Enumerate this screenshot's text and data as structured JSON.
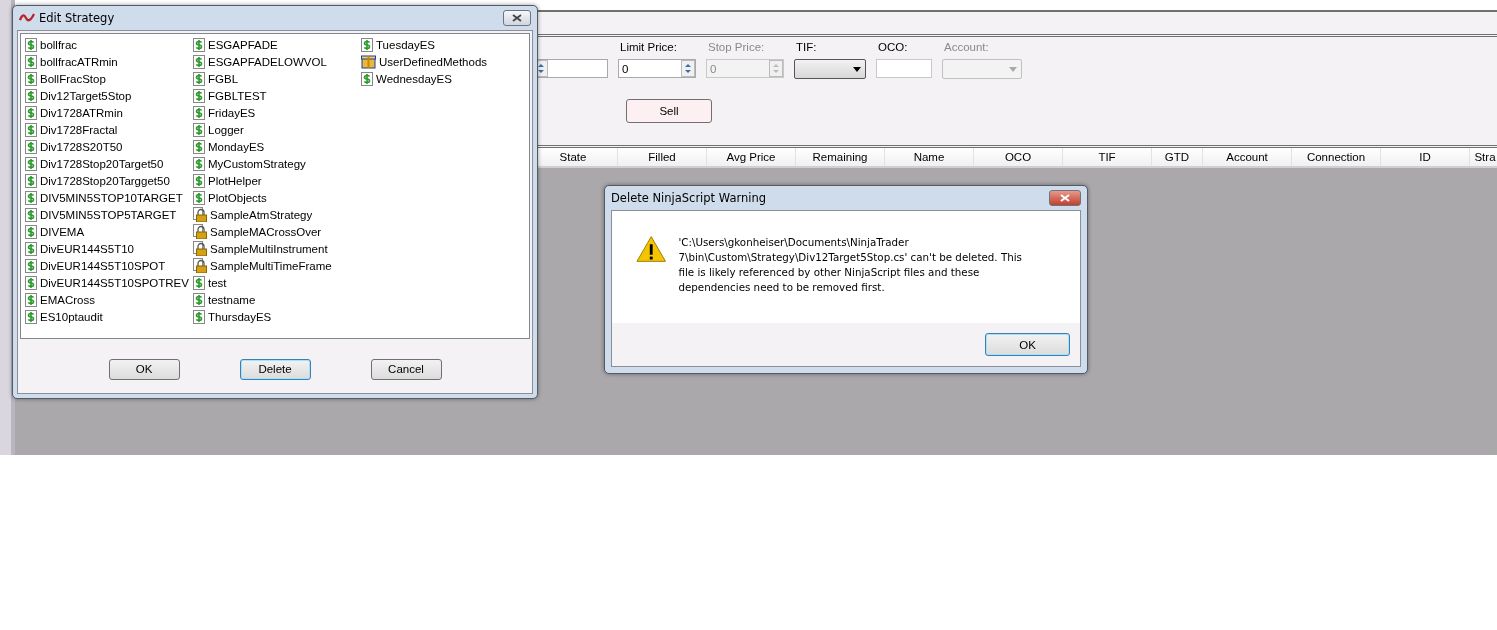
{
  "order_entry": {
    "fields": [
      {
        "kind": "spin",
        "disabled": false
      },
      {
        "kind": "spin",
        "label": "Limit Price:",
        "value": "0",
        "disabled": false
      },
      {
        "kind": "spin",
        "label": "Stop Price:",
        "value": "0",
        "disabled": true
      },
      {
        "kind": "dropdown",
        "label": "TIF:",
        "disabled": false
      },
      {
        "kind": "text",
        "label": "OCO:",
        "disabled": false
      },
      {
        "kind": "dropdown",
        "label": "Account:",
        "disabled": true
      }
    ],
    "sell_button": "Sell"
  },
  "orders_table": {
    "columns": [
      "State",
      "Filled",
      "Avg Price",
      "Remaining",
      "Name",
      "OCO",
      "TIF",
      "GTD",
      "Account",
      "Connection",
      "ID",
      "Stra"
    ]
  },
  "edit_strategy": {
    "title": "Edit Strategy",
    "items": [
      {
        "name": "bollfrac",
        "kind": "script"
      },
      {
        "name": "bollfracATRmin",
        "kind": "script"
      },
      {
        "name": "BollFracStop",
        "kind": "script"
      },
      {
        "name": "Div12Target5Stop",
        "kind": "script"
      },
      {
        "name": "Div1728ATRmin",
        "kind": "script"
      },
      {
        "name": "Div1728Fractal",
        "kind": "script"
      },
      {
        "name": "Div1728S20T50",
        "kind": "script"
      },
      {
        "name": "Div1728Stop20Target50",
        "kind": "script"
      },
      {
        "name": "Div1728Stop20Targget50",
        "kind": "script"
      },
      {
        "name": "DIV5MIN5STOP10TARGET",
        "kind": "script"
      },
      {
        "name": "DIV5MIN5STOP5TARGET",
        "kind": "script"
      },
      {
        "name": "DIVEMA",
        "kind": "script"
      },
      {
        "name": "DivEUR144S5T10",
        "kind": "script"
      },
      {
        "name": "DivEUR144S5T10SPOT",
        "kind": "script"
      },
      {
        "name": "DivEUR144S5T10SPOTREV",
        "kind": "script"
      },
      {
        "name": "EMACross",
        "kind": "script"
      },
      {
        "name": "ES10ptaudit",
        "kind": "script"
      },
      {
        "name": "ESGAPFADE",
        "kind": "script"
      },
      {
        "name": "ESGAPFADELOWVOL",
        "kind": "script"
      },
      {
        "name": "FGBL",
        "kind": "script"
      },
      {
        "name": "FGBLTEST",
        "kind": "script"
      },
      {
        "name": "FridayES",
        "kind": "script"
      },
      {
        "name": "Logger",
        "kind": "script"
      },
      {
        "name": "MondayES",
        "kind": "script"
      },
      {
        "name": "MyCustomStrategy",
        "kind": "script"
      },
      {
        "name": "PlotHelper",
        "kind": "script"
      },
      {
        "name": "PlotObjects",
        "kind": "script"
      },
      {
        "name": "SampleAtmStrategy",
        "kind": "locked"
      },
      {
        "name": "SampleMACrossOver",
        "kind": "locked"
      },
      {
        "name": "SampleMultiInstrument",
        "kind": "locked"
      },
      {
        "name": "SampleMultiTimeFrame",
        "kind": "locked"
      },
      {
        "name": "test",
        "kind": "script"
      },
      {
        "name": "testname",
        "kind": "script"
      },
      {
        "name": "ThursdayES",
        "kind": "script"
      },
      {
        "name": "TuesdayES",
        "kind": "script"
      },
      {
        "name": "UserDefinedMethods",
        "kind": "package"
      },
      {
        "name": "WednesdayES",
        "kind": "script"
      }
    ],
    "buttons": [
      {
        "label": "OK",
        "default": false
      },
      {
        "label": "Delete",
        "default": true
      },
      {
        "label": "Cancel",
        "default": false
      }
    ]
  },
  "warning_dialog": {
    "title": "Delete NinjaScript Warning",
    "message": "'C:\\Users\\gkonheiser\\Documents\\NinjaTrader 7\\bin\\Custom\\Strategy\\Div12Target5Stop.cs' can't be deleted. This file is likely referenced by other NinjaScript files and these dependencies need to be removed first.",
    "button": {
      "label": "OK",
      "default": true
    }
  }
}
